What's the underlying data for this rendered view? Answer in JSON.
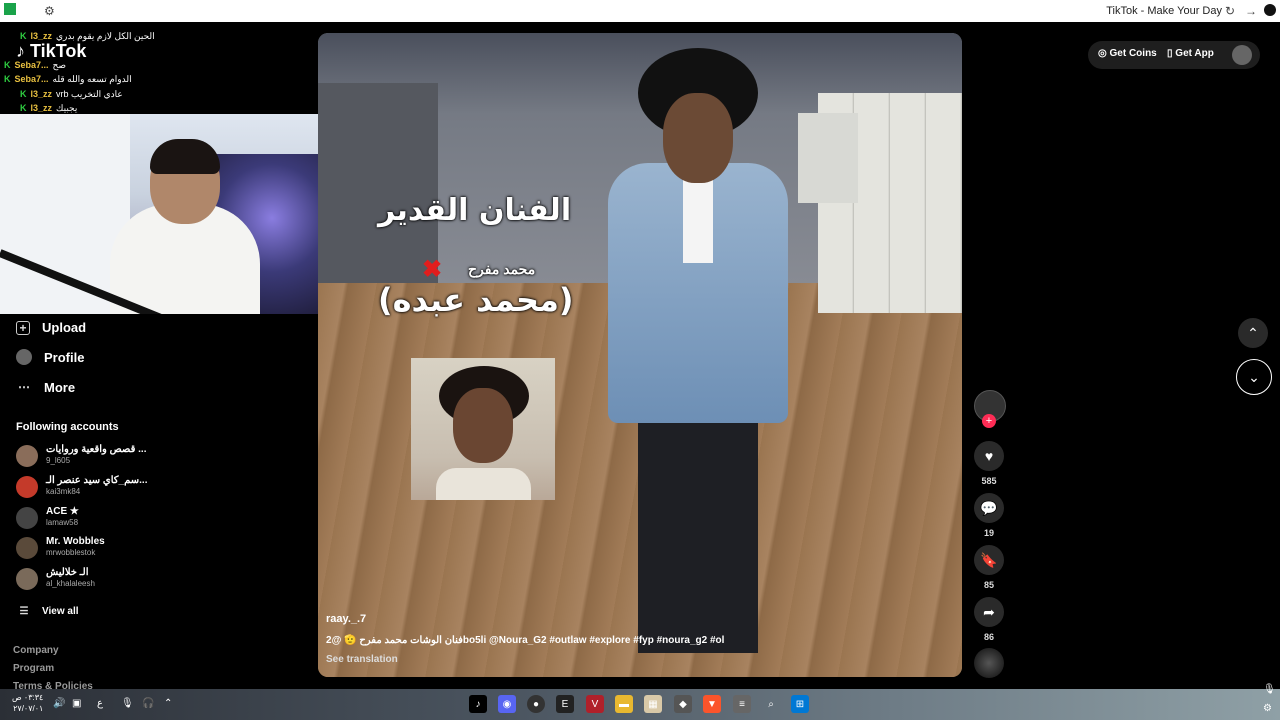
{
  "window": {
    "title": "TikTok - Make Your Day",
    "reload_icon": "reload-icon",
    "forward_icon": "arrow-forward-icon"
  },
  "stream_chat": {
    "lines": [
      {
        "user": "l3_zz",
        "message": "الحين الكل لازم يقوم بدري"
      },
      {
        "user": "Seba7...",
        "message": "صح"
      },
      {
        "user": "Seba7...",
        "message": "الدوام تسعه والله قله"
      },
      {
        "user": "l3_zz",
        "message": "vrb عادي التخريب"
      },
      {
        "user": "l3_zz",
        "message": "يجبيك"
      }
    ]
  },
  "brand": {
    "logo_text": "TikTok"
  },
  "sidebar": {
    "upload": "Upload",
    "profile": "Profile",
    "more": "More",
    "following_title": "Following accounts",
    "accounts": [
      {
        "name": "قصص واقعية وروايات ...",
        "handle": "9_l605",
        "color": "#8a6d5a"
      },
      {
        "name": "سم_كاي سيد عنصر الـ...",
        "handle": "kai3mk84",
        "color": "#c43a2a"
      },
      {
        "name": "ACE ★",
        "handle": "lamaw58",
        "color": "#444444"
      },
      {
        "name": "Mr. Wobbles",
        "handle": "mrwobblestok",
        "color": "#5a4a3a"
      },
      {
        "name": "الـ خلاليش",
        "handle": "al_khalaleesh",
        "color": "#7a6a5a"
      }
    ],
    "view_all": "View all",
    "footer": [
      "Company",
      "Program",
      "Terms & Policies"
    ]
  },
  "video": {
    "overlay_title": "الفنان القدير",
    "overlay_sub": "محمد مفرح",
    "overlay_name": "(محمد عبده)",
    "username": "raay._.7",
    "caption": "فنان الوشات محمد مفرح 🫡 @2bo5li @Noura_G2 #outlaw #explore #fyp #noura_g2 #ol",
    "see_translation": "See translation"
  },
  "actions": {
    "likes": "585",
    "comments": "19",
    "saves": "85",
    "shares": "86"
  },
  "topright": {
    "get_coins": "Get Coins",
    "get_app": "Get App"
  },
  "taskbar": {
    "time": "٠٣:٣٤ ص",
    "date": "٢٧/٠٧/٠١",
    "lang": "ع"
  }
}
